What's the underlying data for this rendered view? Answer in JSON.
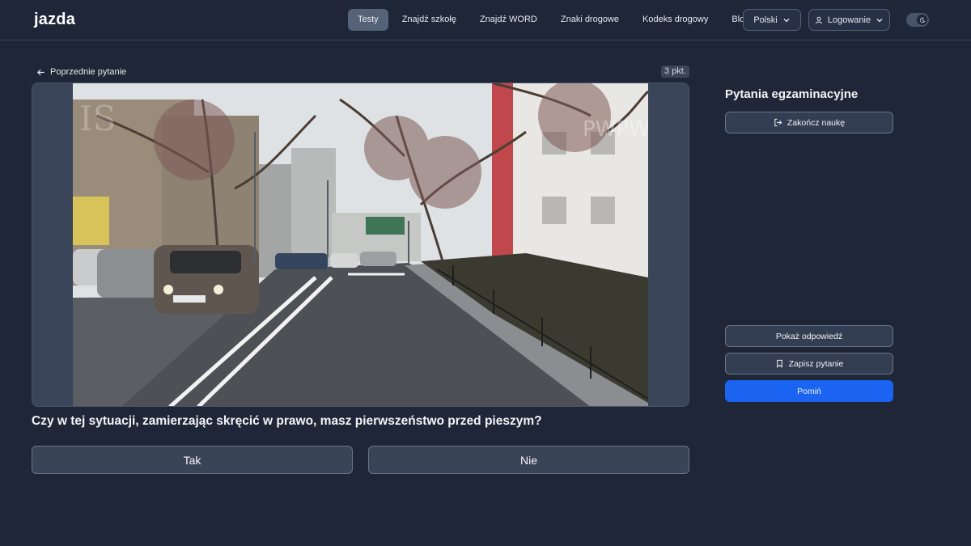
{
  "header": {
    "logo": "jazda",
    "nav": [
      "Testy",
      "Znajdź szkołę",
      "Znajdź WORD",
      "Znaki drogowe",
      "Kodeks drogowy",
      "Blog"
    ],
    "active_nav": "Testy",
    "language": "Polski",
    "login": "Logowanie"
  },
  "main": {
    "back_label": "Poprzednie pytanie",
    "points": "3 pkt.",
    "question": "Czy w tej sytuacji, zamierzając skręcić w prawo, masz pierwszeństwo przed pieszym?",
    "answers": [
      "Tak",
      "Nie"
    ]
  },
  "sidebar": {
    "title": "Pytania egzaminacyjne",
    "finish_label": "Zakończ naukę",
    "show_answer_label": "Pokaż odpowiedź",
    "save_label": "Zapisz pytanie",
    "skip_label": "Pomiń"
  },
  "colors": {
    "background": "#1e2638",
    "accent": "#1b64f2",
    "logo_accent": "#4b8df8",
    "active_nav": "#566277"
  },
  "icons": [
    "arrow-left-icon",
    "chevron-down-icon",
    "user-icon",
    "moon-icon",
    "logout-icon",
    "bookmark-icon"
  ]
}
